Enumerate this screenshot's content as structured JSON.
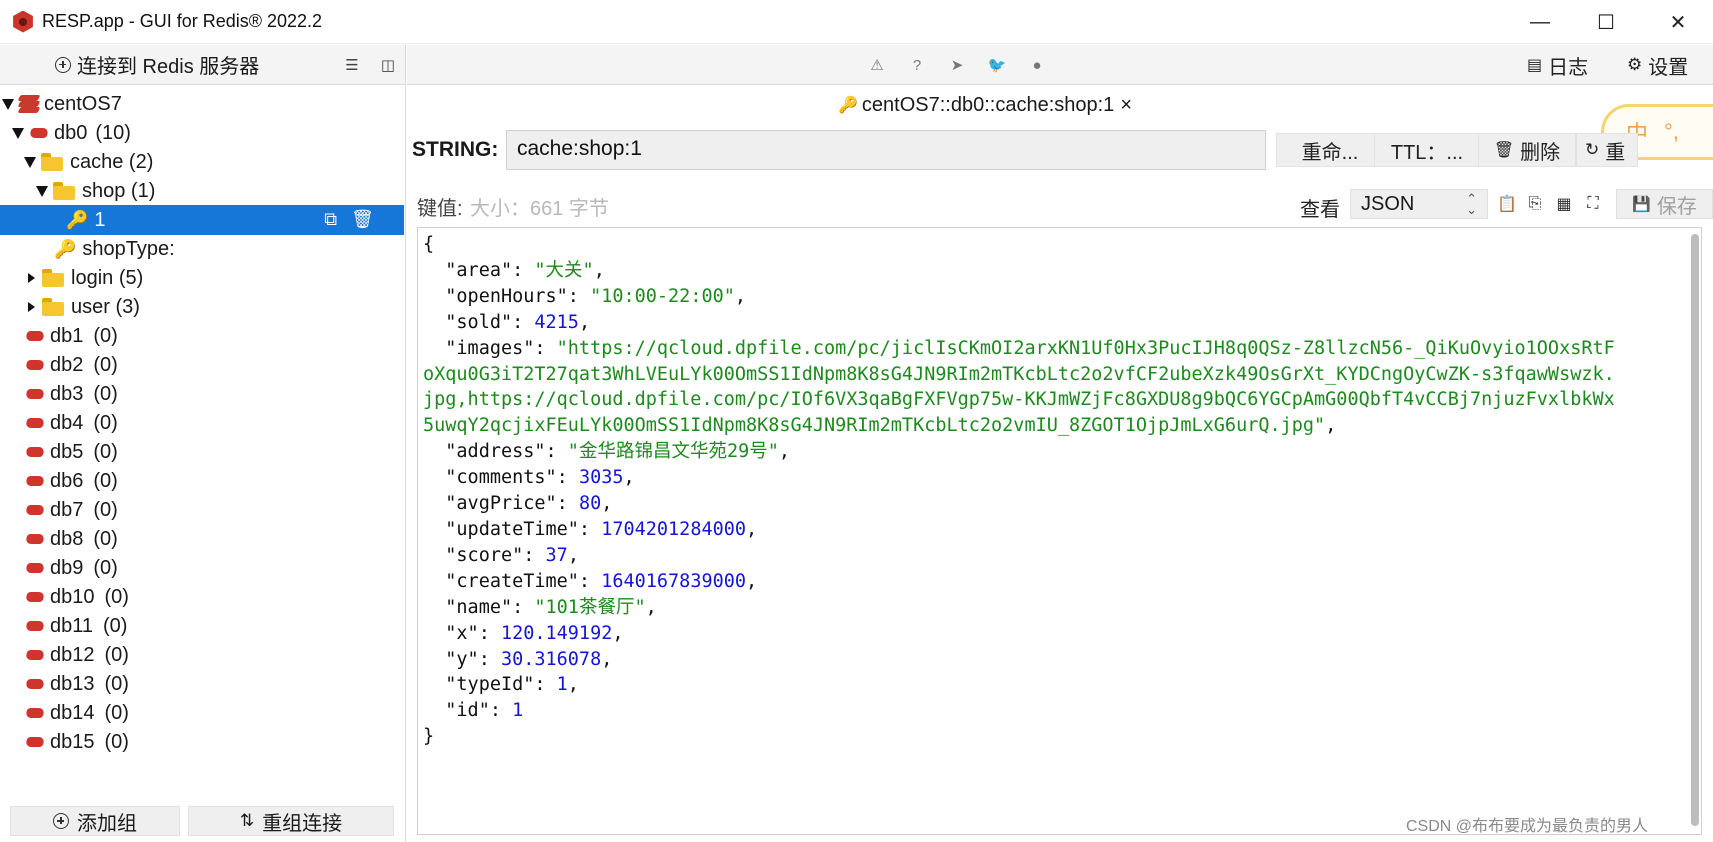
{
  "window": {
    "title": "RESP.app - GUI for Redis® 2022.2",
    "minimize": "—",
    "maximize": "☐",
    "close": "✕"
  },
  "left_toolbar": {
    "connect_label": "连接到 Redis 服务器",
    "list_icon": "list-icon",
    "layout_icon": "panel-layout-icon"
  },
  "right_toolbar": {
    "icons": [
      "warning-icon",
      "help-icon",
      "telegram-icon",
      "twitter-icon",
      "github-icon"
    ],
    "log_label": "日志",
    "settings_label": "设置"
  },
  "tree": {
    "server": "centOS7",
    "db0": "db0",
    "db0_count": "(10)",
    "cache_folder": "cache (2)",
    "shop_folder": "shop (1)",
    "selected_key": "1",
    "shoptype_key": "shopType:",
    "login_folder": "login (5)",
    "user_folder": "user (3)",
    "other_dbs": [
      {
        "name": "db1",
        "count": "(0)"
      },
      {
        "name": "db2",
        "count": "(0)"
      },
      {
        "name": "db3",
        "count": "(0)"
      },
      {
        "name": "db4",
        "count": "(0)"
      },
      {
        "name": "db5",
        "count": "(0)"
      },
      {
        "name": "db6",
        "count": "(0)"
      },
      {
        "name": "db7",
        "count": "(0)"
      },
      {
        "name": "db8",
        "count": "(0)"
      },
      {
        "name": "db9",
        "count": "(0)"
      },
      {
        "name": "db10",
        "count": "(0)"
      },
      {
        "name": "db11",
        "count": "(0)"
      },
      {
        "name": "db12",
        "count": "(0)"
      },
      {
        "name": "db13",
        "count": "(0)"
      },
      {
        "name": "db14",
        "count": "(0)"
      },
      {
        "name": "db15",
        "count": "(0)"
      }
    ]
  },
  "left_bottom": {
    "add_group": "添加组",
    "regroup": "重组连接"
  },
  "tab": {
    "label": "centOS7::db0::cache:shop:1",
    "close": "×"
  },
  "ime": {
    "mode": "中",
    "punct": "°,"
  },
  "key_panel": {
    "type": "STRING:",
    "key_name": "cache:shop:1",
    "rename": "重命...",
    "ttl": "TTL：...",
    "delete": "删除",
    "reload": "重"
  },
  "value_panel": {
    "label": "键值:",
    "size": "大小：661 字节",
    "view_label": "查看",
    "format": "JSON",
    "save": "保存"
  },
  "json_value": {
    "area": "大关",
    "openHours": "10:00-22:00",
    "sold": "4215",
    "images_line1": "https://qcloud.dpfile.com/pc/jiclIsCKmOI2arxKN1Uf0Hx3PucIJH8q0QSz-Z8llzcN56-_QiKuOvyio1OOxsRtF",
    "images_line2": "oXqu0G3iT2T27qat3WhLVEuLYk00OmSS1IdNpm8K8sG4JN9RIm2mTKcbLtc2o2vfCF2ubeXzk49OsGrXt_KYDCngOyCwZK-s3fqawWswzk.",
    "images_line3": "jpg,https://qcloud.dpfile.com/pc/IOf6VX3qaBgFXFVgp75w-KKJmWZjFc8GXDU8g9bQC6YGCpAmG00QbfT4vCCBj7njuzFvxlbkWx",
    "images_line4": "5uwqY2qcjixFEuLYk00OmSS1IdNpm8K8sG4JN9RIm2mTKcbLtc2o2vmIU_8ZGOT1OjpJmLxG6urQ.jpg",
    "address": "金华路锦昌文华苑29号",
    "comments": "3035",
    "avgPrice": "80",
    "updateTime": "1704201284000",
    "score": "37",
    "createTime": "1640167839000",
    "name": "101茶餐厅",
    "x": "120.149192",
    "y": "30.316078",
    "typeId": "1",
    "id": "1"
  },
  "watermark": "CSDN @布布要成为最负责的男人",
  "colors": {
    "selection": "#1677d8",
    "json_string": "#1e8a1e",
    "json_number": "#1515d6",
    "db_icon": "#d0342c",
    "folder": "#f6c530",
    "key_icon": "#e09b1a"
  }
}
